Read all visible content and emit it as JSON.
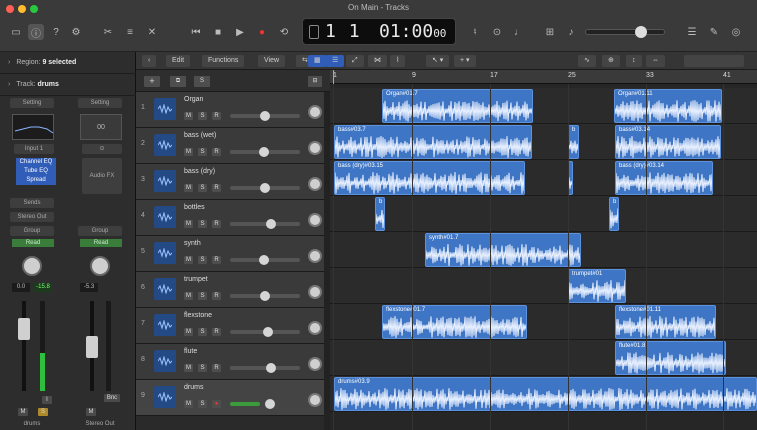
{
  "window": {
    "title": "On Main - Tracks"
  },
  "transport": {
    "bar": "1",
    "beat": "1",
    "time": "01:00",
    "time_sub": "00"
  },
  "inspector": {
    "region_label": "Region:",
    "region_value": "9 selected",
    "track_label": "Track:",
    "track_value": "drums",
    "strip1": {
      "setting": "Setting",
      "input": "Input 1",
      "plugins": [
        "Channel EQ",
        "Tube EQ",
        "Spread"
      ],
      "sends": "Sends",
      "output": "Stereo Out",
      "group": "Group",
      "automation": "Read",
      "val_left": "0.0",
      "val_right": "-15.8",
      "name": "drums",
      "m": "M",
      "s": "S",
      "i": "I"
    },
    "strip2": {
      "setting": "Setting",
      "input": "00",
      "insert": "Audio FX",
      "group": "Group",
      "automation": "Read",
      "val_left": "-5.3",
      "name": "Stereo Out",
      "m": "M",
      "bnc": "Bnc"
    }
  },
  "toolbar": {
    "edit": "Edit",
    "functions": "Functions",
    "view": "View"
  },
  "ruler": [
    "1",
    "9",
    "17",
    "25",
    "33",
    "41"
  ],
  "tracks": [
    {
      "num": "1",
      "name": "Organ"
    },
    {
      "num": "2",
      "name": "bass (wet)"
    },
    {
      "num": "3",
      "name": "bass (dry)"
    },
    {
      "num": "4",
      "name": "bottles"
    },
    {
      "num": "5",
      "name": "synth"
    },
    {
      "num": "6",
      "name": "trumpet"
    },
    {
      "num": "7",
      "name": "flexstone"
    },
    {
      "num": "8",
      "name": "flute"
    },
    {
      "num": "9",
      "name": "drums"
    }
  ],
  "track_buttons": {
    "m": "M",
    "s": "S",
    "r": "R"
  },
  "regions": [
    {
      "lane": 0,
      "start": 52,
      "end": 203,
      "label": "Organ#01.7"
    },
    {
      "lane": 0,
      "start": 284,
      "end": 392,
      "label": "Organ#01.11"
    },
    {
      "lane": 1,
      "start": 4,
      "end": 202,
      "label": "bass#03.7"
    },
    {
      "lane": 1,
      "start": 238,
      "end": 249,
      "label": "b"
    },
    {
      "lane": 1,
      "start": 285,
      "end": 391,
      "label": "bass#03.14"
    },
    {
      "lane": 2,
      "start": 4,
      "end": 195,
      "label": "bass (dry)#03.15"
    },
    {
      "lane": 2,
      "start": 238,
      "end": 243,
      "label": ""
    },
    {
      "lane": 2,
      "start": 285,
      "end": 383,
      "label": "bass (dry)#03.14"
    },
    {
      "lane": 3,
      "start": 45,
      "end": 55,
      "label": "b"
    },
    {
      "lane": 3,
      "start": 279,
      "end": 289,
      "label": "b"
    },
    {
      "lane": 4,
      "start": 95,
      "end": 251,
      "label": "synth#01.7"
    },
    {
      "lane": 5,
      "start": 238,
      "end": 296,
      "label": "trumpet#01"
    },
    {
      "lane": 6,
      "start": 52,
      "end": 197,
      "label": "flexstone#01.7"
    },
    {
      "lane": 6,
      "start": 285,
      "end": 386,
      "label": "flexstone#01.11"
    },
    {
      "lane": 7,
      "start": 285,
      "end": 396,
      "label": "flute#01.8"
    },
    {
      "lane": 8,
      "start": 4,
      "end": 427,
      "label": "drums#03.9"
    }
  ]
}
